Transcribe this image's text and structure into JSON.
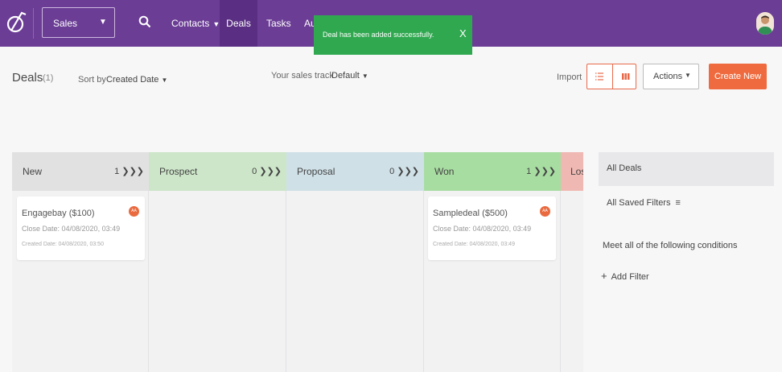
{
  "nav": {
    "module_select": "Sales",
    "items": {
      "contacts": "Contacts",
      "deals": "Deals",
      "tasks": "Tasks",
      "automation": "Au"
    }
  },
  "toast": {
    "message": "Deal has been added successfully.",
    "close": "X"
  },
  "header": {
    "title": "Deals",
    "count": "(1)",
    "sort_label": "Sort by",
    "sort_value": "Created Date",
    "track_label": "Your sales track",
    "track_value": "Default",
    "import": "Import",
    "actions": "Actions",
    "create": "Create New"
  },
  "columns": [
    {
      "name": "New",
      "count": "1 ❯❯❯",
      "color": "#e1e1e1"
    },
    {
      "name": "Prospect",
      "count": "0 ❯❯❯",
      "color": "#cde6c9"
    },
    {
      "name": "Proposal",
      "count": "0 ❯❯❯",
      "color": "#cfe0e7"
    },
    {
      "name": "Won",
      "count": "1 ❯❯❯",
      "color": "#a8dda2"
    },
    {
      "name": "Los",
      "count": "",
      "color": "#f0b8b2"
    }
  ],
  "cards": [
    {
      "title": "Engagebay ($100)",
      "close_date": "Close Date: 04/08/2020, 03:49",
      "created_date": "Created Date: 04/08/2020, 03:50",
      "owner": "AA"
    },
    {
      "title": "Sampledeal ($500)",
      "close_date": "Close Date: 04/08/2020, 03:49",
      "created_date": "Created Date: 04/08/2020, 03:49",
      "owner": "AA"
    }
  ],
  "filters": {
    "all_deals": "All Deals",
    "saved_filters": "All Saved Filters",
    "conditions": "Meet all of the following conditions",
    "add_filter": "Add Filter"
  },
  "colors": {
    "topbar": "#6b3d95",
    "accent": "#ef6b3f",
    "toast": "#2fa84f"
  },
  "icons": [
    "logo-icon",
    "search-icon",
    "list-view-icon",
    "board-view-icon",
    "filter-icon",
    "plus-icon",
    "avatar"
  ]
}
